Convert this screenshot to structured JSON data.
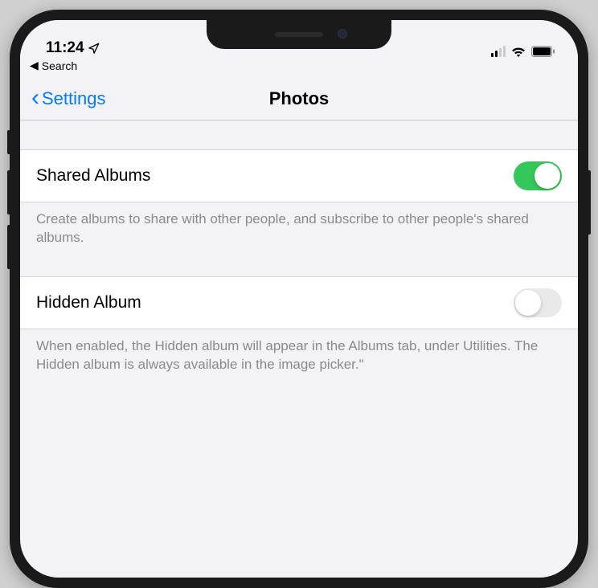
{
  "status": {
    "time": "11:24",
    "breadcrumb_label": "Search"
  },
  "nav": {
    "back_label": "Settings",
    "title": "Photos"
  },
  "sections": [
    {
      "label": "Shared Albums",
      "toggle_on": true,
      "footer": "Create albums to share with other people, and subscribe to other people's shared albums."
    },
    {
      "label": "Hidden Album",
      "toggle_on": false,
      "footer": "When enabled, the Hidden album will appear in the Albums tab, under Utilities. The Hidden album is always available in the image picker.\""
    }
  ]
}
